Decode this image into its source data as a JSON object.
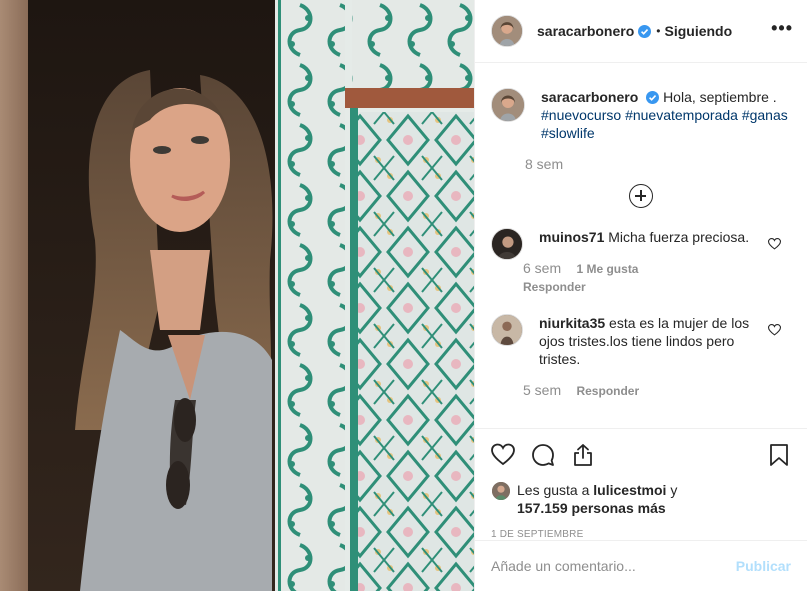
{
  "post": {
    "author": "saracarbonero",
    "follow_sep": "•",
    "follow_label": "Siguiendo",
    "more_label": "•••"
  },
  "caption": {
    "username": "saracarbonero",
    "text": "Hola, septiembre .",
    "hashtags": [
      "#nuevocurso",
      "#nuevatemporada",
      "#ganas",
      "#slowlife"
    ],
    "age": "8 sem"
  },
  "comments": [
    {
      "username": "muinos71",
      "text": "Micha fuerza preciosa.",
      "age": "6 sem",
      "likes": "1 Me gusta",
      "reply": "Responder"
    },
    {
      "username": "niurkita35",
      "text": "esta es la mujer de los ojos tristes.los tiene lindos pero tristes.",
      "age": "5 sem",
      "reply": "Responder"
    }
  ],
  "likes": {
    "prefix": "Les gusta a",
    "user": "lulicestmoi",
    "conj": "y",
    "count": "157.159 personas más"
  },
  "date": "1 DE SEPTIEMBRE",
  "composer": {
    "placeholder": "Añade un comentario...",
    "publish_label": "Publicar"
  },
  "icons": {
    "like": "heart-icon",
    "comment": "comment-bubble-icon",
    "share": "share-icon",
    "save": "bookmark-icon",
    "verified": "verified-badge-icon",
    "add": "plus-circle-icon"
  },
  "colors": {
    "verified": "#3897f0",
    "hashtag": "#00376b",
    "muted": "#8e8e8e",
    "publish_disabled": "#b2dffc"
  }
}
